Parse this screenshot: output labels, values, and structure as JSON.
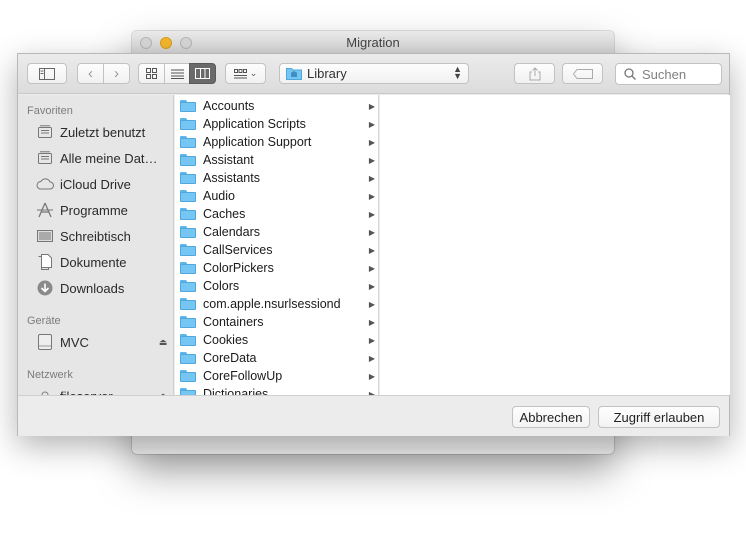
{
  "background_window": {
    "title": "Migration"
  },
  "toolbar": {
    "path_popup": "Library",
    "search_placeholder": "Suchen"
  },
  "sidebar": {
    "sections": [
      {
        "title": "Favoriten",
        "items": [
          {
            "label": "Zuletzt benutzt",
            "icon": "recents-icon"
          },
          {
            "label": "Alle meine Dat…",
            "icon": "all-files-icon"
          },
          {
            "label": "iCloud Drive",
            "icon": "cloud-icon"
          },
          {
            "label": "Programme",
            "icon": "applications-icon"
          },
          {
            "label": "Schreibtisch",
            "icon": "desktop-icon"
          },
          {
            "label": "Dokumente",
            "icon": "documents-icon"
          },
          {
            "label": "Downloads",
            "icon": "downloads-icon"
          }
        ]
      },
      {
        "title": "Geräte",
        "items": [
          {
            "label": "MVC",
            "icon": "disk-icon",
            "eject": "⏏"
          }
        ]
      },
      {
        "title": "Netzwerk",
        "items": [
          {
            "label": "fileserver",
            "icon": "server-icon",
            "eject": "⏏"
          }
        ]
      }
    ]
  },
  "column1": {
    "items": [
      "Accounts",
      "Application Scripts",
      "Application Support",
      "Assistant",
      "Assistants",
      "Audio",
      "Caches",
      "Calendars",
      "CallServices",
      "ColorPickers",
      "Colors",
      "com.apple.nsurlsessiond",
      "Containers",
      "Cookies",
      "CoreData",
      "CoreFollowUp",
      "Dictionaries"
    ]
  },
  "footer": {
    "cancel_label": "Abbrechen",
    "allow_label": "Zugriff erlauben"
  },
  "colors": {
    "folder_blue": "#76c6f3",
    "minimize_yellow": "#f5b82e"
  }
}
